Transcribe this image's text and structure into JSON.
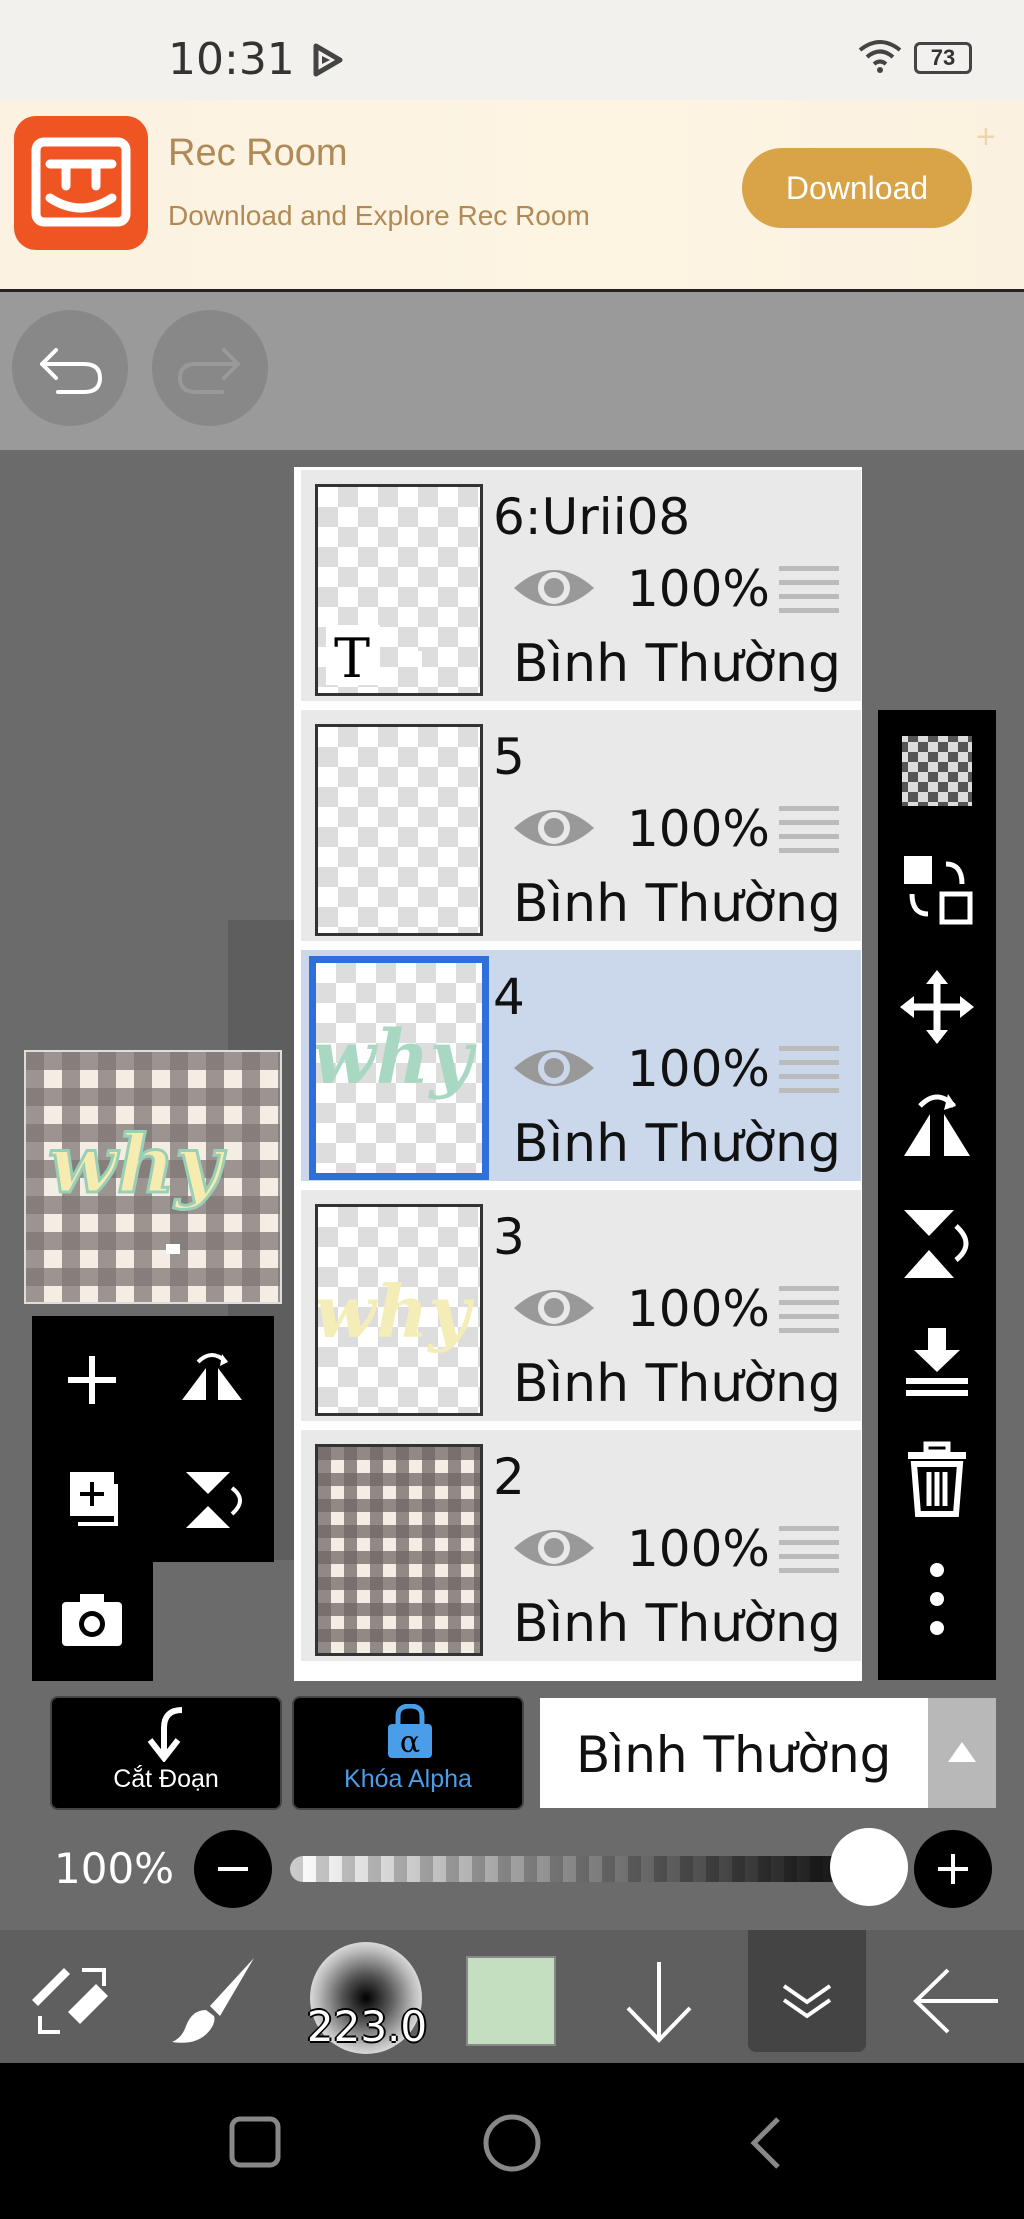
{
  "status_bar": {
    "time": "10:31",
    "battery": "73"
  },
  "ad": {
    "app_name": "Rec Room",
    "tagline": "Download and Explore Rec Room",
    "cta": "Download"
  },
  "layers": [
    {
      "name": "6:Urii08",
      "opacity": "100%",
      "blend": "Bình Thường",
      "selected": false
    },
    {
      "name": "5",
      "opacity": "100%",
      "blend": "Bình Thường",
      "selected": false
    },
    {
      "name": "4",
      "opacity": "100%",
      "blend": "Bình Thường",
      "selected": true
    },
    {
      "name": "3",
      "opacity": "100%",
      "blend": "Bình Thường",
      "selected": false
    },
    {
      "name": "2",
      "opacity": "100%",
      "blend": "Bình Thường",
      "selected": false
    }
  ],
  "layer_controls": {
    "clip_label": "Cắt Đoạn",
    "alpha_lock_label": "Khóa Alpha",
    "blend_mode": "Bình Thường",
    "opacity_label": "100%",
    "opacity_value": 1.0
  },
  "bottom_bar": {
    "brush_size": "223.0",
    "current_color": "#c3dfc0"
  },
  "colors": {
    "accent_blue": "#2f6fdc",
    "selected_row": "#cbd7ea",
    "ad_button": "#d9a448",
    "brand_orange": "#ef5523"
  }
}
